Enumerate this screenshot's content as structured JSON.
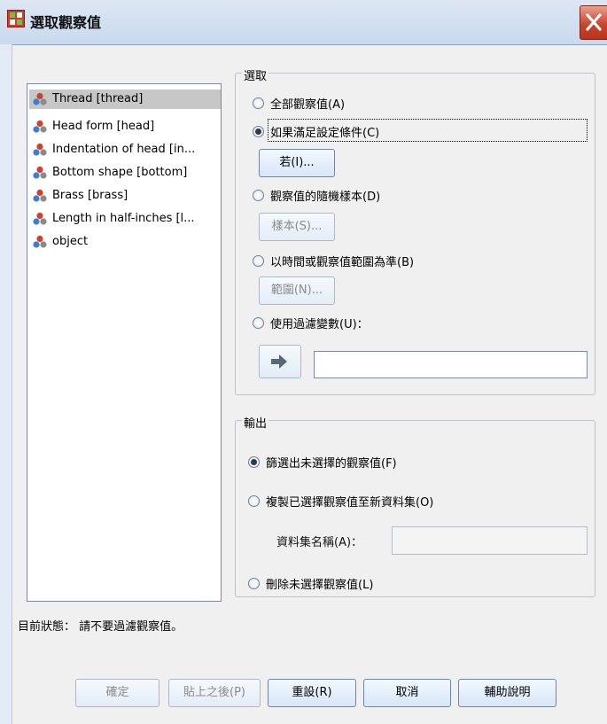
{
  "window": {
    "title": "選取觀察值"
  },
  "variables": [
    {
      "label": "Thread [thread]",
      "selected": true
    },
    {
      "label": "Head form [head]"
    },
    {
      "label": "Indentation of head [in..."
    },
    {
      "label": "Bottom shape [bottom]"
    },
    {
      "label": "Brass [brass]"
    },
    {
      "label": "Length in half-inches [l..."
    },
    {
      "label": "object"
    }
  ],
  "select_group": {
    "label": "選取",
    "options": [
      {
        "label": "全部觀察值(A)",
        "checked": false
      },
      {
        "label": "如果滿足設定條件(C)",
        "checked": true
      },
      {
        "label": "觀察值的隨機樣本(D)",
        "checked": false
      },
      {
        "label": "以時間或觀察值範圍為準(B)",
        "checked": false
      },
      {
        "label": "使用過濾變數(U)：",
        "checked": false
      }
    ],
    "if_button": "若(I)...",
    "sample_button": "樣本(S)...",
    "range_button": "範圍(N)...",
    "arrow_icon": "right-arrow-icon",
    "filter_value": ""
  },
  "output_group": {
    "label": "輸出",
    "options": [
      {
        "label": "篩選出未選擇的觀察值(F)",
        "checked": true
      },
      {
        "label": "複製已選擇觀察值至新資料集(O)",
        "checked": false
      },
      {
        "label": "刪除未選擇觀察值(L)",
        "checked": false
      }
    ],
    "dataset_name_label": "資料集名稱(A)：",
    "dataset_name_value": ""
  },
  "status": "目前狀態： 請不要過濾觀察值。",
  "buttons": {
    "ok": "確定",
    "paste": "貼上之後(P)",
    "reset": "重設(R)",
    "cancel": "取消",
    "help": "輔助說明"
  },
  "colors": {
    "icon_red": "#d0402c",
    "icon_blue": "#3a7fd0",
    "icon_gray": "#8a8a8a"
  }
}
